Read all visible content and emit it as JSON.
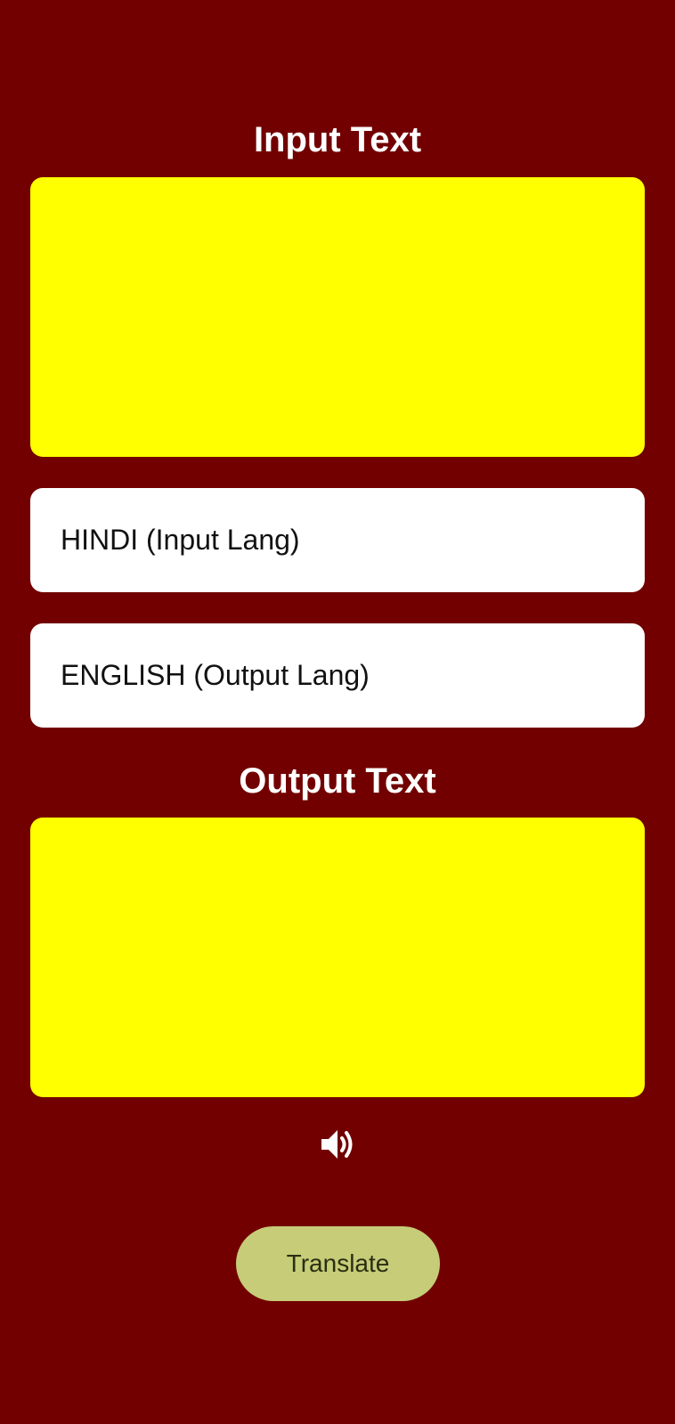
{
  "input_section": {
    "heading": "Input Text",
    "value": ""
  },
  "language": {
    "input": "HINDI (Input Lang)",
    "output": "ENGLISH (Output Lang)"
  },
  "output_section": {
    "heading": "Output Text",
    "value": ""
  },
  "speaker": {
    "icon": "speaker-volume-icon"
  },
  "actions": {
    "translate_label": "Translate"
  },
  "colors": {
    "background": "#720000",
    "text_area": "#ffff00",
    "select_bg": "#ffffff",
    "button": "#c6cc78"
  }
}
